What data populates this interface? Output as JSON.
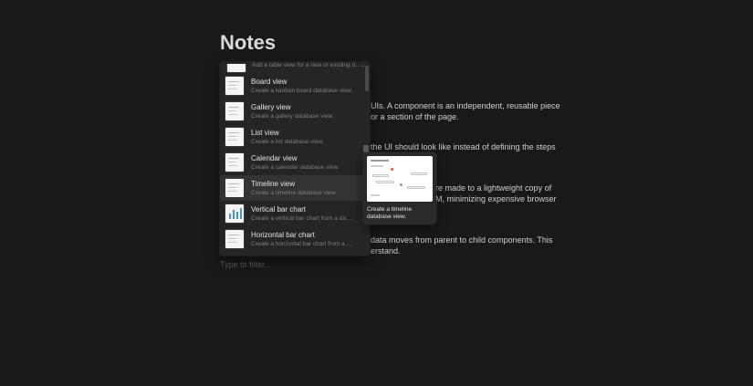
{
  "page": {
    "title": "Notes"
  },
  "paragraphs": [
    "UIs. A component is an independent, reusable piece",
    "or a section of the page.",
    "the UI should look like instead of defining the steps",
    "re made to a lightweight copy of",
    "M, minimizing expensive browser",
    "data moves from parent to child components. This",
    "erstand."
  ],
  "menu": {
    "top_item": {
      "description": "Add a table view for a new or existing d...",
      "chevron": "⌄"
    },
    "items": [
      {
        "label": "Board view",
        "description": "Create a kanban board database view."
      },
      {
        "label": "Gallery view",
        "description": "Create a gallery database view."
      },
      {
        "label": "List view",
        "description": "Create a list database view."
      },
      {
        "label": "Calendar view",
        "description": "Create a calendar database view."
      },
      {
        "label": "Timeline view",
        "description": "Create a timeline database view.",
        "active": true
      },
      {
        "label": "Vertical bar chart",
        "description": "Create a vertical bar chart from a datab..."
      },
      {
        "label": "Horizontal bar chart",
        "description": "Create a horizontal bar chart from a dat..."
      }
    ]
  },
  "preview": {
    "caption": "Create a timeline database view."
  },
  "filter": {
    "placeholder": "Type to filter..."
  },
  "colors": {
    "background": "#191919",
    "menu": "#252525",
    "accent_red": "#e2574c",
    "accent_blue": "#4a8fdb"
  }
}
